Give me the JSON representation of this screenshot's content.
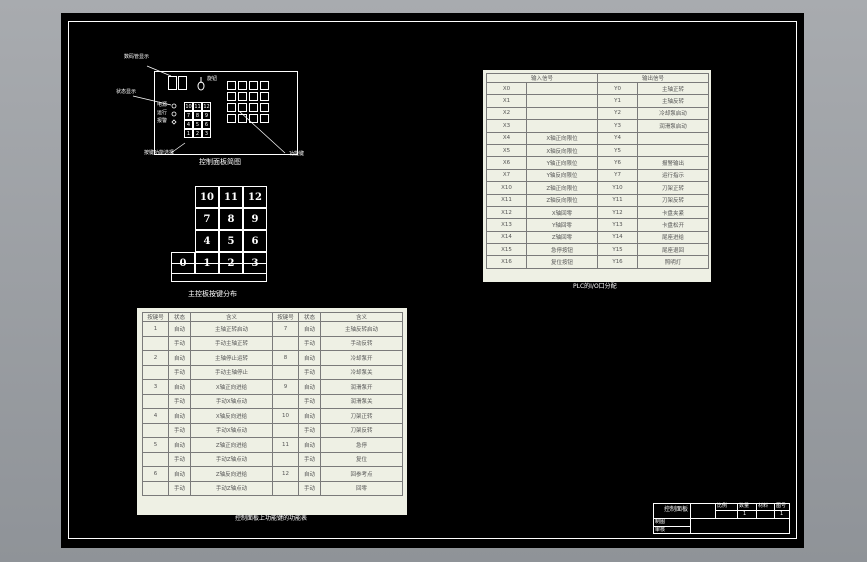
{
  "panel_diagram": {
    "callouts": {
      "digital_display": "数码管显示",
      "status_light": "状态显示",
      "function_keys": "功能键",
      "select_keys": "按键功能选择",
      "knob": "旋钮"
    },
    "indicator_labels": [
      "电源",
      "运行",
      "报警"
    ],
    "keys": [
      "10",
      "11",
      "12",
      "7",
      "8",
      "9",
      "4",
      "5",
      "6",
      "1",
      "2",
      "3"
    ],
    "caption": "控制面板简图"
  },
  "keyboard": {
    "rows": [
      [
        "10",
        "11",
        "12"
      ],
      [
        "7",
        "8",
        "9"
      ],
      [
        "4",
        "5",
        "6"
      ],
      [
        "0",
        "1",
        "2",
        "3"
      ]
    ],
    "caption": "主控板按键分布"
  },
  "io_table": {
    "headers": [
      "输入信号",
      "输出信号"
    ],
    "rows": [
      [
        "X0",
        "",
        "Y0",
        "主轴正转"
      ],
      [
        "X1",
        "",
        "Y1",
        "主轴反转"
      ],
      [
        "X2",
        "",
        "Y2",
        "冷却泵启动"
      ],
      [
        "X3",
        "",
        "Y3",
        "润滑泵启动"
      ],
      [
        "X4",
        "X轴正向限位",
        "Y4",
        ""
      ],
      [
        "X5",
        "X轴反向限位",
        "Y5",
        ""
      ],
      [
        "X6",
        "Y轴正向限位",
        "Y6",
        "报警输出"
      ],
      [
        "X7",
        "Y轴反向限位",
        "Y7",
        "运行指示"
      ],
      [
        "X10",
        "Z轴正向限位",
        "Y10",
        "刀架正转"
      ],
      [
        "X11",
        "Z轴反向限位",
        "Y11",
        "刀架反转"
      ],
      [
        "X12",
        "X轴回零",
        "Y12",
        "卡盘夹紧"
      ],
      [
        "X13",
        "Y轴回零",
        "Y13",
        "卡盘松开"
      ],
      [
        "X14",
        "Z轴回零",
        "Y14",
        "尾座进给"
      ],
      [
        "X15",
        "急停按钮",
        "Y15",
        "尾座退回"
      ],
      [
        "X16",
        "复位按钮",
        "Y16",
        "照明灯"
      ]
    ],
    "caption": "PLC的I/O口分配"
  },
  "key_function_table": {
    "headers": [
      "按键号",
      "状态",
      "含义",
      "按键号",
      "状态",
      "含义"
    ],
    "rows": [
      [
        "1",
        "自动",
        "主轴正转启动",
        "7",
        "自动",
        "主轴反转启动"
      ],
      [
        "",
        "手动",
        "手动主轴正转",
        "",
        "手动",
        "手动反转"
      ],
      [
        "2",
        "自动",
        "主轴停止运转",
        "8",
        "自动",
        "冷却泵开"
      ],
      [
        "",
        "手动",
        "手动主轴停止",
        "",
        "手动",
        "冷却泵关"
      ],
      [
        "3",
        "自动",
        "X轴正向进给",
        "9",
        "自动",
        "润滑泵开"
      ],
      [
        "",
        "手动",
        "手动X轴点动",
        "",
        "手动",
        "润滑泵关"
      ],
      [
        "4",
        "自动",
        "X轴反向进给",
        "10",
        "自动",
        "刀架正转"
      ],
      [
        "",
        "手动",
        "手动X轴点动",
        "",
        "手动",
        "刀架反转"
      ],
      [
        "5",
        "自动",
        "Z轴正向进给",
        "11",
        "自动",
        "急停"
      ],
      [
        "",
        "手动",
        "手动Z轴点动",
        "",
        "手动",
        "复位"
      ],
      [
        "6",
        "自动",
        "Z轴反向进给",
        "12",
        "自动",
        "回参考点"
      ],
      [
        "",
        "手动",
        "手动Z轴点动",
        "",
        "手动",
        "回零"
      ]
    ],
    "caption": "控制面板上功能键的功能表"
  },
  "title_block": {
    "drawing_title": "控制面板",
    "fields": [
      "比例",
      "数量",
      "材料",
      "图号"
    ],
    "row_labels": [
      "制图",
      "审核"
    ],
    "sheet": "1",
    "total": "1"
  }
}
